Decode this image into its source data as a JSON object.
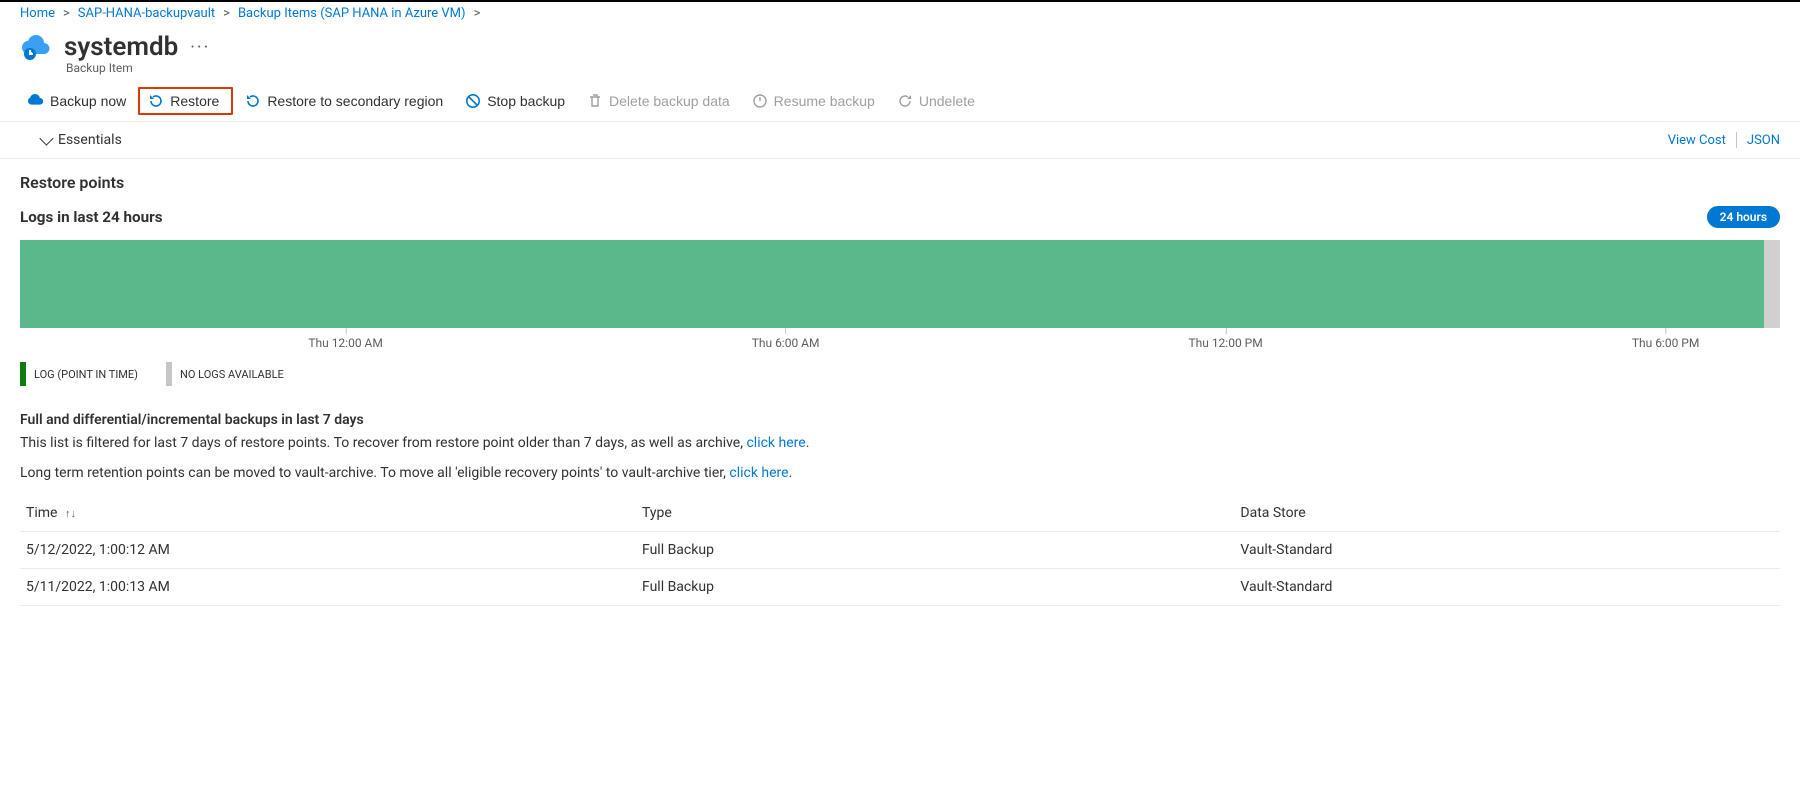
{
  "breadcrumb": {
    "home": "Home",
    "vault": "SAP-HANA-backupvault",
    "items": "Backup Items (SAP HANA in Azure VM)"
  },
  "header": {
    "title": "systemdb",
    "subtitle": "Backup Item"
  },
  "toolbar": {
    "backup_now": "Backup now",
    "restore": "Restore",
    "restore_secondary": "Restore to secondary region",
    "stop_backup": "Stop backup",
    "delete_backup": "Delete backup data",
    "resume_backup": "Resume backup",
    "undelete": "Undelete"
  },
  "essentials": {
    "label": "Essentials",
    "view_cost": "View Cost",
    "json": "JSON"
  },
  "restore_points": {
    "heading": "Restore points"
  },
  "logs": {
    "heading": "Logs in last 24 hours",
    "range_pill": "24 hours",
    "legend_log": "LOG (POINT IN TIME)",
    "legend_none": "NO LOGS AVAILABLE"
  },
  "chart_data": {
    "type": "bar",
    "title": "Logs in last 24 hours",
    "xlabel": "",
    "ylabel": "",
    "categories": [
      "Thu 12:00 AM",
      "Thu 6:00 AM",
      "Thu 12:00 PM",
      "Thu 6:00 PM"
    ],
    "series": [
      {
        "name": "LOG (POINT IN TIME)",
        "color": "#5ab88a",
        "coverage_percent": 99
      },
      {
        "name": "NO LOGS AVAILABLE",
        "color": "#d2d0ce",
        "coverage_percent": 1
      }
    ],
    "tick_positions_percent": [
      18.5,
      43.5,
      68.5,
      93.5
    ]
  },
  "full_backups": {
    "heading": "Full and differential/incremental backups in last 7 days",
    "filter_note_prefix": "This list is filtered for last 7 days of restore points. To recover from restore point older than 7 days, as well as archive, ",
    "filter_note_link": "click here",
    "archive_note_prefix": "Long term retention points can be moved to vault-archive. To move all 'eligible recovery points' to vault-archive tier, ",
    "archive_note_link": "click here",
    "columns": {
      "time": "Time",
      "type": "Type",
      "store": "Data Store"
    },
    "rows": [
      {
        "time": "5/12/2022, 1:00:12 AM",
        "type": "Full Backup",
        "store": "Vault-Standard"
      },
      {
        "time": "5/11/2022, 1:00:13 AM",
        "type": "Full Backup",
        "store": "Vault-Standard"
      }
    ]
  }
}
